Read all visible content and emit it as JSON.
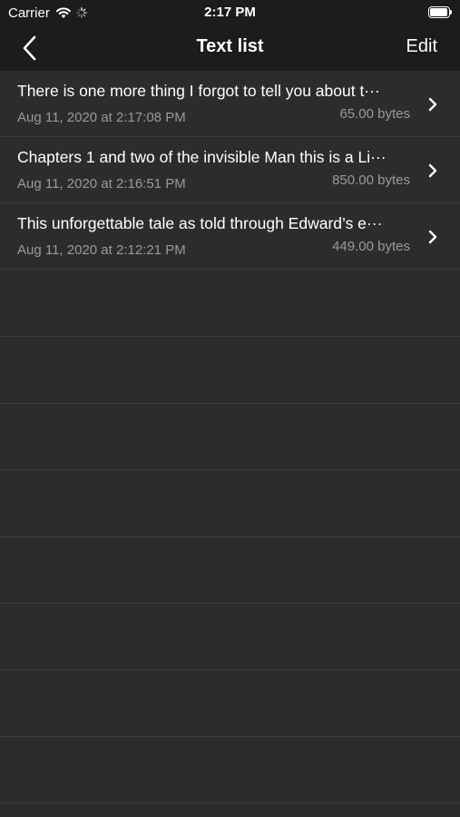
{
  "status_bar": {
    "carrier": "Carrier",
    "time": "2:17 PM"
  },
  "nav": {
    "title": "Text list",
    "edit_label": "Edit",
    "back_icon": "chevron-left-icon"
  },
  "items": [
    {
      "title": "There is one more thing I forgot to tell you about t···",
      "date": "Aug 11, 2020 at 2:17:08 PM",
      "size": "65.00 bytes"
    },
    {
      "title": "Chapters 1 and two of the invisible Man this is a Li···",
      "date": "Aug 11, 2020 at 2:16:51 PM",
      "size": "850.00 bytes"
    },
    {
      "title": "This unforgettable tale as told through Edward’s e···",
      "date": "Aug 11, 2020 at 2:12:21 PM",
      "size": "449.00 bytes"
    }
  ],
  "colors": {
    "background": "#2c2c2e",
    "bar": "#1c1c1e",
    "separator": "#3d3d40",
    "secondary_text": "#9a9a9e"
  }
}
